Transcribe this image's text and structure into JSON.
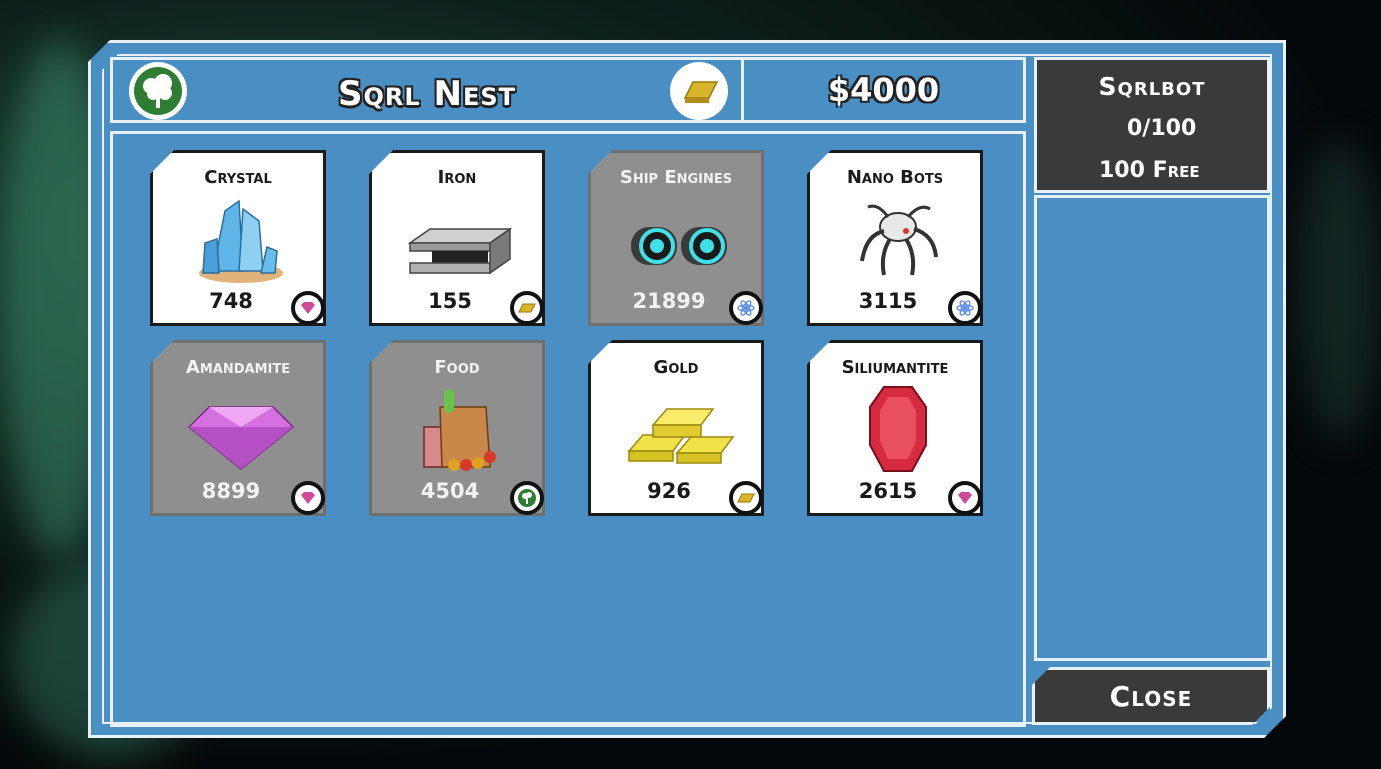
{
  "header": {
    "title": "Sqrl Nest",
    "money": "$4000",
    "nest_icon": "tree-icon",
    "currency_icon": "gold-bar-icon"
  },
  "sidebar": {
    "bot_title": "Sqrlbot",
    "capacity": "0/100",
    "free": "100 Free"
  },
  "close_label": "Close",
  "colors": {
    "panel_blue": "#4a8fc4",
    "border": "#e8f1f8",
    "dark": "#3a3a3a",
    "gem_pink": "#d04a9a",
    "tech_blue": "#5a8ae0",
    "nature_green": "#2e7d32",
    "gold": "#d8b428"
  },
  "items": [
    {
      "name": "Crystal",
      "value": "748",
      "badge": "gem-icon",
      "dim": false,
      "art": "crystal-icon"
    },
    {
      "name": "Iron",
      "value": "155",
      "badge": "gold-bar-icon",
      "dim": false,
      "art": "iron-beam-icon"
    },
    {
      "name": "Ship Engines",
      "value": "21899",
      "badge": "atom-icon",
      "dim": true,
      "art": "engine-icon"
    },
    {
      "name": "Nano Bots",
      "value": "3115",
      "badge": "atom-icon",
      "dim": false,
      "art": "nanobot-icon"
    },
    {
      "name": "Amandamite",
      "value": "8899",
      "badge": "gem-icon",
      "dim": true,
      "art": "amandamite-gem-icon"
    },
    {
      "name": "Food",
      "value": "4504",
      "badge": "tree-icon",
      "dim": true,
      "art": "grocery-bag-icon"
    },
    {
      "name": "Gold",
      "value": "926",
      "badge": "gold-bar-icon",
      "dim": false,
      "art": "gold-bars-icon"
    },
    {
      "name": "Siliumantite",
      "value": "2615",
      "badge": "gem-icon",
      "dim": false,
      "art": "ruby-icon"
    }
  ]
}
